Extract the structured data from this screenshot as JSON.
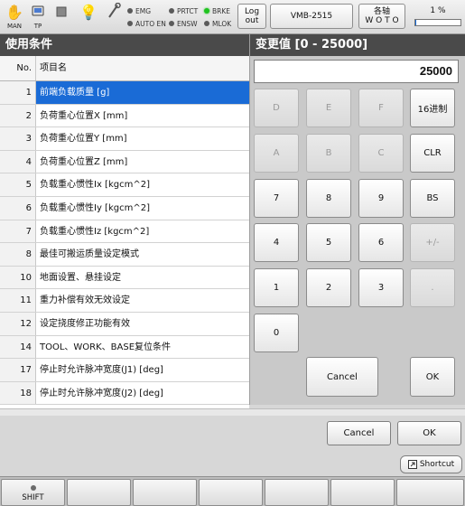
{
  "status": {
    "mode_icon": "hand-icon",
    "mode_label": "MAN",
    "tp_icon": "teach-pendant-icon",
    "tp_label": "TP",
    "stop_icon": "square-stop-icon",
    "lamp_icon": "bulb-icon",
    "tool_icon": "wrench-icon",
    "indicators": [
      {
        "label": "EMG",
        "on": false
      },
      {
        "label": "AUTO EN",
        "on": false
      },
      {
        "label": "PRTCT",
        "on": false
      },
      {
        "label": "ENSW",
        "on": false
      },
      {
        "label": "BRKE",
        "on": true
      },
      {
        "label": "MLOK",
        "on": false
      }
    ],
    "logout_line1": "Log",
    "logout_line2": "out",
    "robot_name": "VMB-2515",
    "axis_line1": "各轴",
    "axis_line2": "W O T O",
    "speed": "1 %",
    "indicator_on_color": "#1ec31e"
  },
  "conditions": {
    "title": "使用条件",
    "col_no": "No.",
    "col_name": "项目名",
    "selected_color": "#1a6bd6",
    "rows": [
      {
        "no": "1",
        "name": "前端负载质量 [g]",
        "selected": true
      },
      {
        "no": "2",
        "name": "负荷重心位置X [mm]"
      },
      {
        "no": "3",
        "name": "负荷重心位置Y [mm]"
      },
      {
        "no": "4",
        "name": "负荷重心位置Z [mm]"
      },
      {
        "no": "5",
        "name": "负载重心惯性Ix [kgcm^2]"
      },
      {
        "no": "6",
        "name": "负载重心惯性Iy [kgcm^2]"
      },
      {
        "no": "7",
        "name": "负载重心惯性Iz [kgcm^2]"
      },
      {
        "no": "8",
        "name": "最佳可搬运质量设定模式"
      },
      {
        "no": "10",
        "name": "地面设置、悬挂设定"
      },
      {
        "no": "11",
        "name": "重力补偿有效无效设定"
      },
      {
        "no": "12",
        "name": "设定挠度修正功能有效"
      },
      {
        "no": "14",
        "name": "TOOL、WORK、BASE复位条件"
      },
      {
        "no": "17",
        "name": "停止时允许脉冲宽度(J1) [deg]"
      },
      {
        "no": "18",
        "name": "停止时允许脉冲宽度(J2) [deg]"
      }
    ]
  },
  "keypad": {
    "title": "变更值 [0 - 25000]",
    "value": "25000",
    "keys": [
      {
        "label": "D",
        "enabled": false
      },
      {
        "label": "E",
        "enabled": false
      },
      {
        "label": "F",
        "enabled": false
      },
      {
        "label": "16进制",
        "enabled": true
      },
      {
        "label": "A",
        "enabled": false
      },
      {
        "label": "B",
        "enabled": false
      },
      {
        "label": "C",
        "enabled": false
      },
      {
        "label": "CLR",
        "enabled": true
      },
      {
        "label": "7",
        "enabled": true
      },
      {
        "label": "8",
        "enabled": true
      },
      {
        "label": "9",
        "enabled": true
      },
      {
        "label": "BS",
        "enabled": true
      },
      {
        "label": "4",
        "enabled": true
      },
      {
        "label": "5",
        "enabled": true
      },
      {
        "label": "6",
        "enabled": true
      },
      {
        "label": "+/-",
        "enabled": false
      },
      {
        "label": "1",
        "enabled": true
      },
      {
        "label": "2",
        "enabled": true
      },
      {
        "label": "3",
        "enabled": true
      },
      {
        "label": ".",
        "enabled": false
      },
      {
        "label": "0",
        "enabled": true
      }
    ],
    "cancel": "Cancel",
    "ok": "OK"
  },
  "dialog": {
    "cancel": "Cancel",
    "ok": "OK"
  },
  "shortcut": {
    "icon": "shortcut-icon",
    "label": "Shortcut"
  },
  "function_keys": {
    "f1": "SHIFT",
    "f2": "",
    "f3": "",
    "f4": "",
    "f5": "",
    "f6": "",
    "f7": ""
  }
}
